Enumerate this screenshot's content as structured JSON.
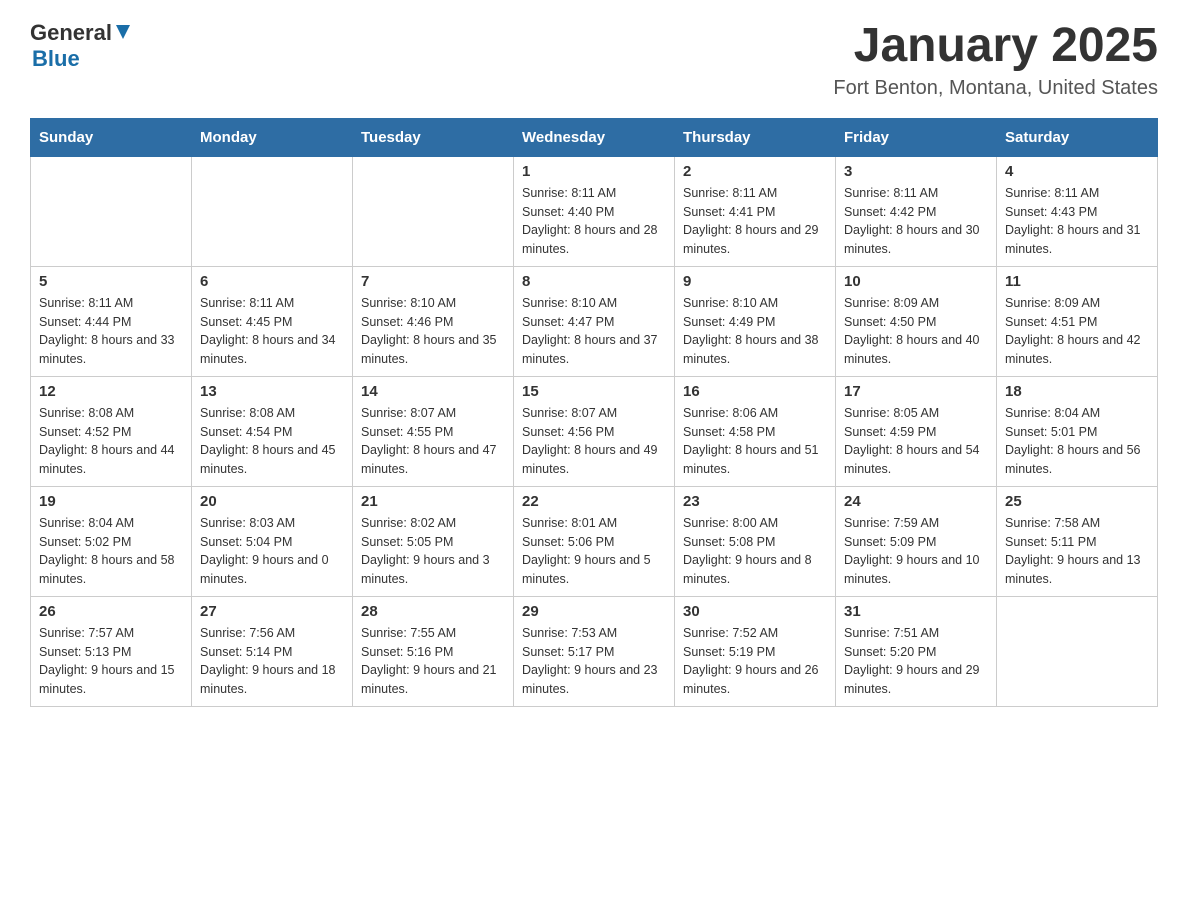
{
  "header": {
    "logo_general": "General",
    "logo_blue": "Blue",
    "title": "January 2025",
    "subtitle": "Fort Benton, Montana, United States"
  },
  "columns": [
    "Sunday",
    "Monday",
    "Tuesday",
    "Wednesday",
    "Thursday",
    "Friday",
    "Saturday"
  ],
  "weeks": [
    [
      {
        "day": "",
        "sunrise": "",
        "sunset": "",
        "daylight": ""
      },
      {
        "day": "",
        "sunrise": "",
        "sunset": "",
        "daylight": ""
      },
      {
        "day": "",
        "sunrise": "",
        "sunset": "",
        "daylight": ""
      },
      {
        "day": "1",
        "sunrise": "Sunrise: 8:11 AM",
        "sunset": "Sunset: 4:40 PM",
        "daylight": "Daylight: 8 hours and 28 minutes."
      },
      {
        "day": "2",
        "sunrise": "Sunrise: 8:11 AM",
        "sunset": "Sunset: 4:41 PM",
        "daylight": "Daylight: 8 hours and 29 minutes."
      },
      {
        "day": "3",
        "sunrise": "Sunrise: 8:11 AM",
        "sunset": "Sunset: 4:42 PM",
        "daylight": "Daylight: 8 hours and 30 minutes."
      },
      {
        "day": "4",
        "sunrise": "Sunrise: 8:11 AM",
        "sunset": "Sunset: 4:43 PM",
        "daylight": "Daylight: 8 hours and 31 minutes."
      }
    ],
    [
      {
        "day": "5",
        "sunrise": "Sunrise: 8:11 AM",
        "sunset": "Sunset: 4:44 PM",
        "daylight": "Daylight: 8 hours and 33 minutes."
      },
      {
        "day": "6",
        "sunrise": "Sunrise: 8:11 AM",
        "sunset": "Sunset: 4:45 PM",
        "daylight": "Daylight: 8 hours and 34 minutes."
      },
      {
        "day": "7",
        "sunrise": "Sunrise: 8:10 AM",
        "sunset": "Sunset: 4:46 PM",
        "daylight": "Daylight: 8 hours and 35 minutes."
      },
      {
        "day": "8",
        "sunrise": "Sunrise: 8:10 AM",
        "sunset": "Sunset: 4:47 PM",
        "daylight": "Daylight: 8 hours and 37 minutes."
      },
      {
        "day": "9",
        "sunrise": "Sunrise: 8:10 AM",
        "sunset": "Sunset: 4:49 PM",
        "daylight": "Daylight: 8 hours and 38 minutes."
      },
      {
        "day": "10",
        "sunrise": "Sunrise: 8:09 AM",
        "sunset": "Sunset: 4:50 PM",
        "daylight": "Daylight: 8 hours and 40 minutes."
      },
      {
        "day": "11",
        "sunrise": "Sunrise: 8:09 AM",
        "sunset": "Sunset: 4:51 PM",
        "daylight": "Daylight: 8 hours and 42 minutes."
      }
    ],
    [
      {
        "day": "12",
        "sunrise": "Sunrise: 8:08 AM",
        "sunset": "Sunset: 4:52 PM",
        "daylight": "Daylight: 8 hours and 44 minutes."
      },
      {
        "day": "13",
        "sunrise": "Sunrise: 8:08 AM",
        "sunset": "Sunset: 4:54 PM",
        "daylight": "Daylight: 8 hours and 45 minutes."
      },
      {
        "day": "14",
        "sunrise": "Sunrise: 8:07 AM",
        "sunset": "Sunset: 4:55 PM",
        "daylight": "Daylight: 8 hours and 47 minutes."
      },
      {
        "day": "15",
        "sunrise": "Sunrise: 8:07 AM",
        "sunset": "Sunset: 4:56 PM",
        "daylight": "Daylight: 8 hours and 49 minutes."
      },
      {
        "day": "16",
        "sunrise": "Sunrise: 8:06 AM",
        "sunset": "Sunset: 4:58 PM",
        "daylight": "Daylight: 8 hours and 51 minutes."
      },
      {
        "day": "17",
        "sunrise": "Sunrise: 8:05 AM",
        "sunset": "Sunset: 4:59 PM",
        "daylight": "Daylight: 8 hours and 54 minutes."
      },
      {
        "day": "18",
        "sunrise": "Sunrise: 8:04 AM",
        "sunset": "Sunset: 5:01 PM",
        "daylight": "Daylight: 8 hours and 56 minutes."
      }
    ],
    [
      {
        "day": "19",
        "sunrise": "Sunrise: 8:04 AM",
        "sunset": "Sunset: 5:02 PM",
        "daylight": "Daylight: 8 hours and 58 minutes."
      },
      {
        "day": "20",
        "sunrise": "Sunrise: 8:03 AM",
        "sunset": "Sunset: 5:04 PM",
        "daylight": "Daylight: 9 hours and 0 minutes."
      },
      {
        "day": "21",
        "sunrise": "Sunrise: 8:02 AM",
        "sunset": "Sunset: 5:05 PM",
        "daylight": "Daylight: 9 hours and 3 minutes."
      },
      {
        "day": "22",
        "sunrise": "Sunrise: 8:01 AM",
        "sunset": "Sunset: 5:06 PM",
        "daylight": "Daylight: 9 hours and 5 minutes."
      },
      {
        "day": "23",
        "sunrise": "Sunrise: 8:00 AM",
        "sunset": "Sunset: 5:08 PM",
        "daylight": "Daylight: 9 hours and 8 minutes."
      },
      {
        "day": "24",
        "sunrise": "Sunrise: 7:59 AM",
        "sunset": "Sunset: 5:09 PM",
        "daylight": "Daylight: 9 hours and 10 minutes."
      },
      {
        "day": "25",
        "sunrise": "Sunrise: 7:58 AM",
        "sunset": "Sunset: 5:11 PM",
        "daylight": "Daylight: 9 hours and 13 minutes."
      }
    ],
    [
      {
        "day": "26",
        "sunrise": "Sunrise: 7:57 AM",
        "sunset": "Sunset: 5:13 PM",
        "daylight": "Daylight: 9 hours and 15 minutes."
      },
      {
        "day": "27",
        "sunrise": "Sunrise: 7:56 AM",
        "sunset": "Sunset: 5:14 PM",
        "daylight": "Daylight: 9 hours and 18 minutes."
      },
      {
        "day": "28",
        "sunrise": "Sunrise: 7:55 AM",
        "sunset": "Sunset: 5:16 PM",
        "daylight": "Daylight: 9 hours and 21 minutes."
      },
      {
        "day": "29",
        "sunrise": "Sunrise: 7:53 AM",
        "sunset": "Sunset: 5:17 PM",
        "daylight": "Daylight: 9 hours and 23 minutes."
      },
      {
        "day": "30",
        "sunrise": "Sunrise: 7:52 AM",
        "sunset": "Sunset: 5:19 PM",
        "daylight": "Daylight: 9 hours and 26 minutes."
      },
      {
        "day": "31",
        "sunrise": "Sunrise: 7:51 AM",
        "sunset": "Sunset: 5:20 PM",
        "daylight": "Daylight: 9 hours and 29 minutes."
      },
      {
        "day": "",
        "sunrise": "",
        "sunset": "",
        "daylight": ""
      }
    ]
  ]
}
